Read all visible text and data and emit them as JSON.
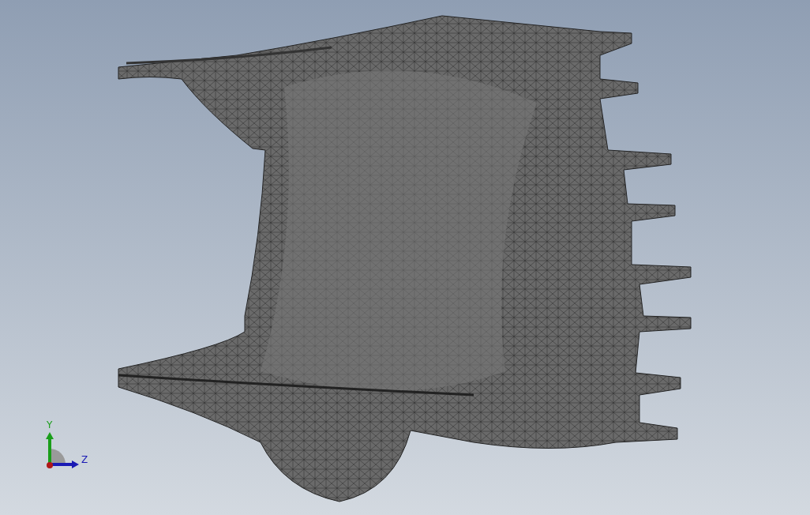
{
  "viewport": {
    "triad": {
      "axes": [
        {
          "label": "Y",
          "color": "#1a9e1a"
        },
        {
          "label": "Z",
          "color": "#1a1ab4"
        }
      ]
    }
  }
}
